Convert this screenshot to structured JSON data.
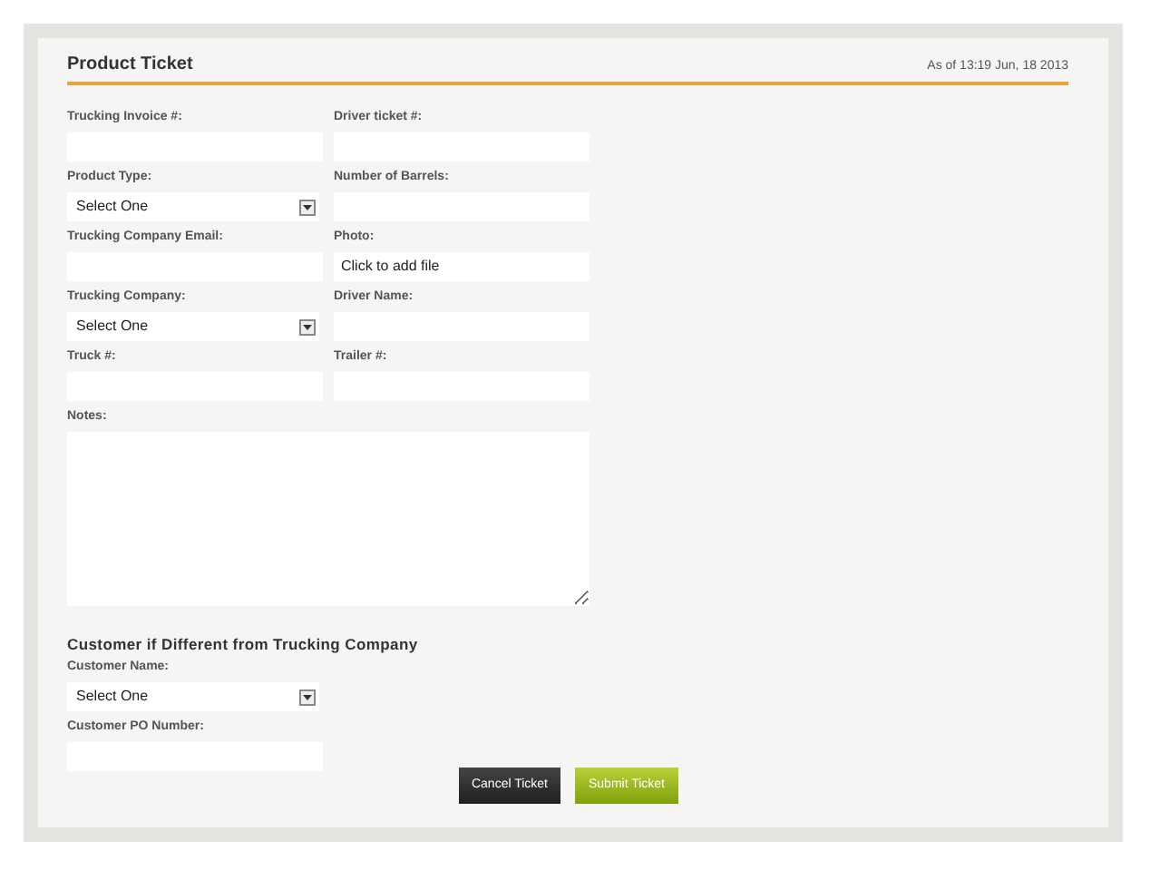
{
  "header": {
    "title": "Product Ticket",
    "timestamp": "As of 13:19 Jun, 18  2013"
  },
  "field_rows": [
    [
      {
        "label": "Trucking Invoice #:",
        "kind": "text"
      },
      {
        "label": "Driver ticket #:",
        "kind": "text"
      }
    ],
    [
      {
        "label": "Product Type:",
        "kind": "select",
        "value": "Select One"
      },
      {
        "label": "Number of Barrels:",
        "kind": "text"
      }
    ],
    [
      {
        "label": "Trucking Company Email:",
        "kind": "text"
      },
      {
        "label": "Photo:",
        "kind": "file",
        "value": "Click to add file"
      }
    ],
    [
      {
        "label": "Trucking Company:",
        "kind": "select",
        "value": "Select One"
      },
      {
        "label": "Driver Name:",
        "kind": "text"
      }
    ],
    [
      {
        "label": "Truck #:",
        "kind": "text"
      },
      {
        "label": "Trailer #:",
        "kind": "text"
      }
    ]
  ],
  "notes": {
    "label": "Notes:"
  },
  "customer_section": {
    "heading": "Customer if Different from Trucking Company",
    "fields": [
      {
        "label": "Customer Name:",
        "kind": "select",
        "value": "Select One"
      },
      {
        "label": "Customer PO Number:",
        "kind": "text"
      }
    ]
  },
  "buttons": [
    {
      "label": "Cancel Ticket",
      "kind": "cancel"
    },
    {
      "label": "Submit Ticket",
      "kind": "submit"
    }
  ]
}
